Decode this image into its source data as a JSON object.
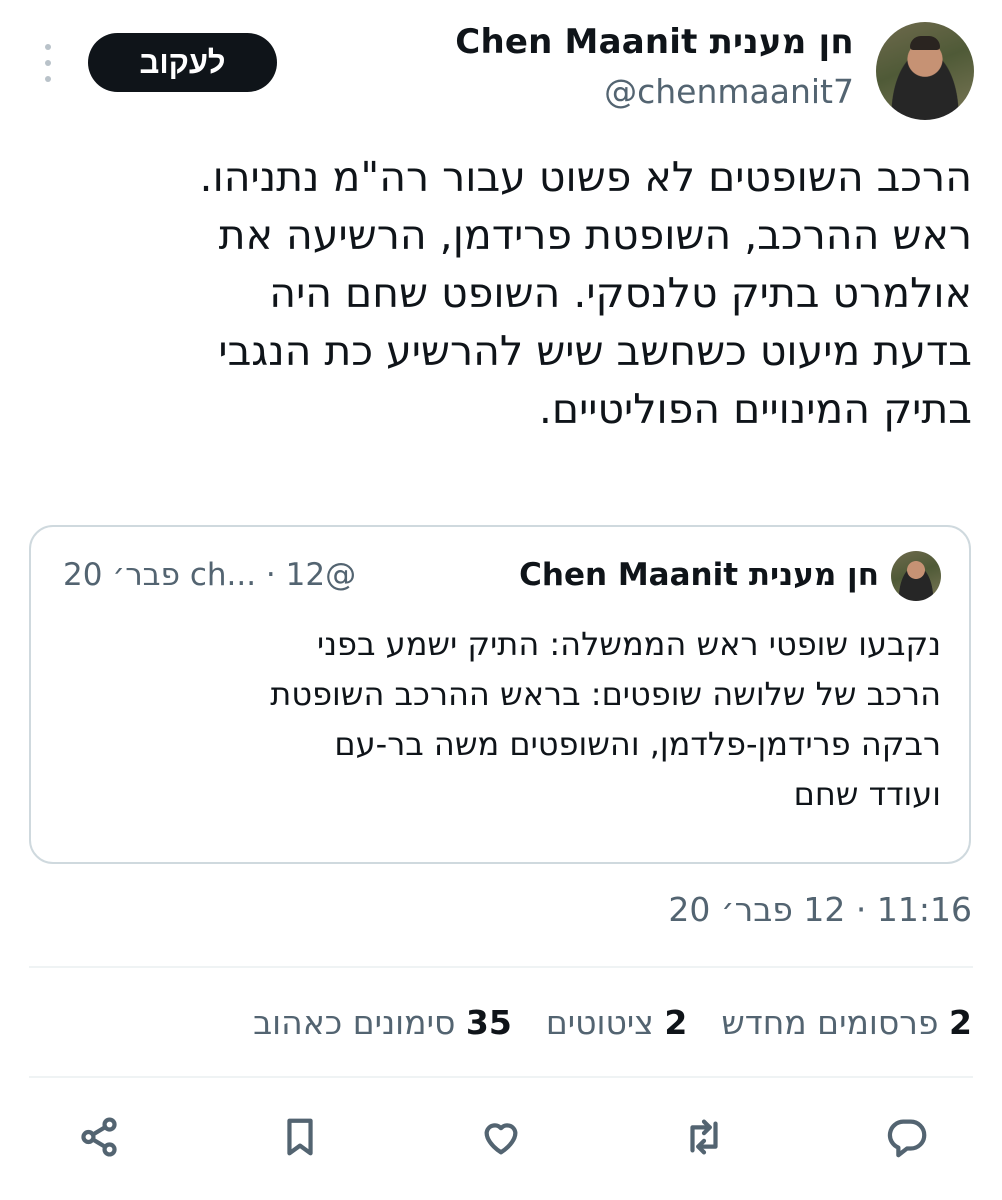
{
  "header": {
    "display_name": "חן מענית Chen Maanit",
    "handle": "@chenmaanit7",
    "follow_label": "לעקוב"
  },
  "tweet": {
    "lines": [
      "הרכב השופטים לא פשוט עבור רה\"מ נתניהו.",
      "ראש ההרכב, השופטת פרידמן, הרשיעה את",
      "אולמרט בתיק טלנסקי. השופט שחם היה",
      "בדעת מיעוט כשחשב שיש להרשיע כת הנגבי",
      "בתיק המינויים הפוליטיים."
    ],
    "timestamp": "11:16 · 12 פבר׳ 20"
  },
  "quote": {
    "display_name": "חן מענית Chen Maanit",
    "meta": "@ch... · 12 פבר׳ 20",
    "lines": [
      "נקבעו שופטי ראש הממשלה: התיק ישמע בפני",
      "הרכב של שלושה שופטים: בראש ההרכב השופטת",
      "רבקה פרידמן-פלדמן, והשופטים משה בר-עם",
      "ועודד שחם"
    ]
  },
  "stats": {
    "retweets_count": "2",
    "retweets_label": "פרסומים מחדש",
    "quotes_count": "2",
    "quotes_label": "ציטוטים",
    "likes_count": "35",
    "likes_label": "סימונים כאהוב"
  },
  "actions": {
    "reply_icon": "reply-icon",
    "retweet_icon": "retweet-icon",
    "like_icon": "heart-icon",
    "bookmark_icon": "bookmark-icon",
    "share_icon": "share-icon"
  },
  "colors": {
    "text": "#0f1419",
    "secondary": "#536471",
    "border": "#cfd9de",
    "button_bg": "#0f1419"
  }
}
